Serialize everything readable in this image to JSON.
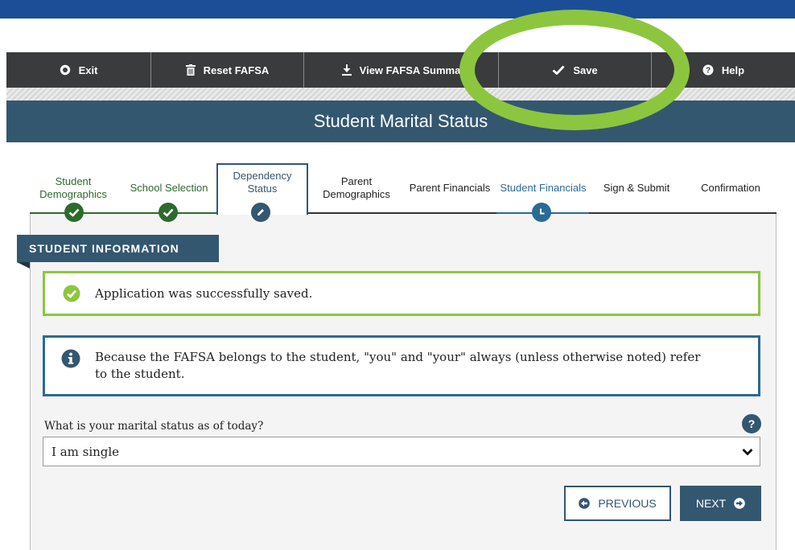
{
  "toolbar": {
    "exit_label": "Exit",
    "reset_label": "Reset FAFSA",
    "view_summary_label": "View FAFSA Summa",
    "save_label": "Save",
    "help_label": "Help"
  },
  "page": {
    "title": "Student Marital Status"
  },
  "steps": [
    {
      "label": "Student Demographics",
      "status": "complete"
    },
    {
      "label": "School Selection",
      "status": "complete"
    },
    {
      "label": "Dependency Status",
      "status": "in-progress"
    },
    {
      "label": "Parent Demographics",
      "status": "not-started"
    },
    {
      "label": "Parent Financials",
      "status": "not-started"
    },
    {
      "label": "Student Financials",
      "status": "pending"
    },
    {
      "label": "Sign & Submit",
      "status": "not-started"
    },
    {
      "label": "Confirmation",
      "status": "not-started"
    }
  ],
  "section": {
    "title": "STUDENT INFORMATION"
  },
  "alerts": {
    "success": "Application was successfully saved.",
    "info": "Because the FAFSA belongs to the student, \"you\" and \"your\" always (unless otherwise noted) refer to the student."
  },
  "form": {
    "marital_question": "What is your marital status as of today?",
    "help_glyph": "?",
    "marital_value": "I am single"
  },
  "nav": {
    "previous_label": "PREVIOUS",
    "next_label": "NEXT"
  },
  "colors": {
    "top_bar": "#1b4e96",
    "toolbar": "#3a3b3c",
    "title_bar": "#345770",
    "success": "#8cc63f",
    "info": "#2a6b96",
    "complete_step": "#2d6a2d",
    "highlight_ring": "#8cc63f"
  },
  "icons": {
    "exit": "exit-circle-icon",
    "reset": "trash-icon",
    "view_summary": "download-icon",
    "save": "checkmark-icon",
    "help": "question-circle-icon",
    "step_complete": "check-circle-icon",
    "step_in_progress": "pencil-icon",
    "step_pending": "clock-icon",
    "success": "check-circle-icon",
    "info": "info-circle-icon",
    "select": "chevron-down-icon",
    "previous": "arrow-left-circle-icon",
    "next": "arrow-right-circle-icon"
  }
}
